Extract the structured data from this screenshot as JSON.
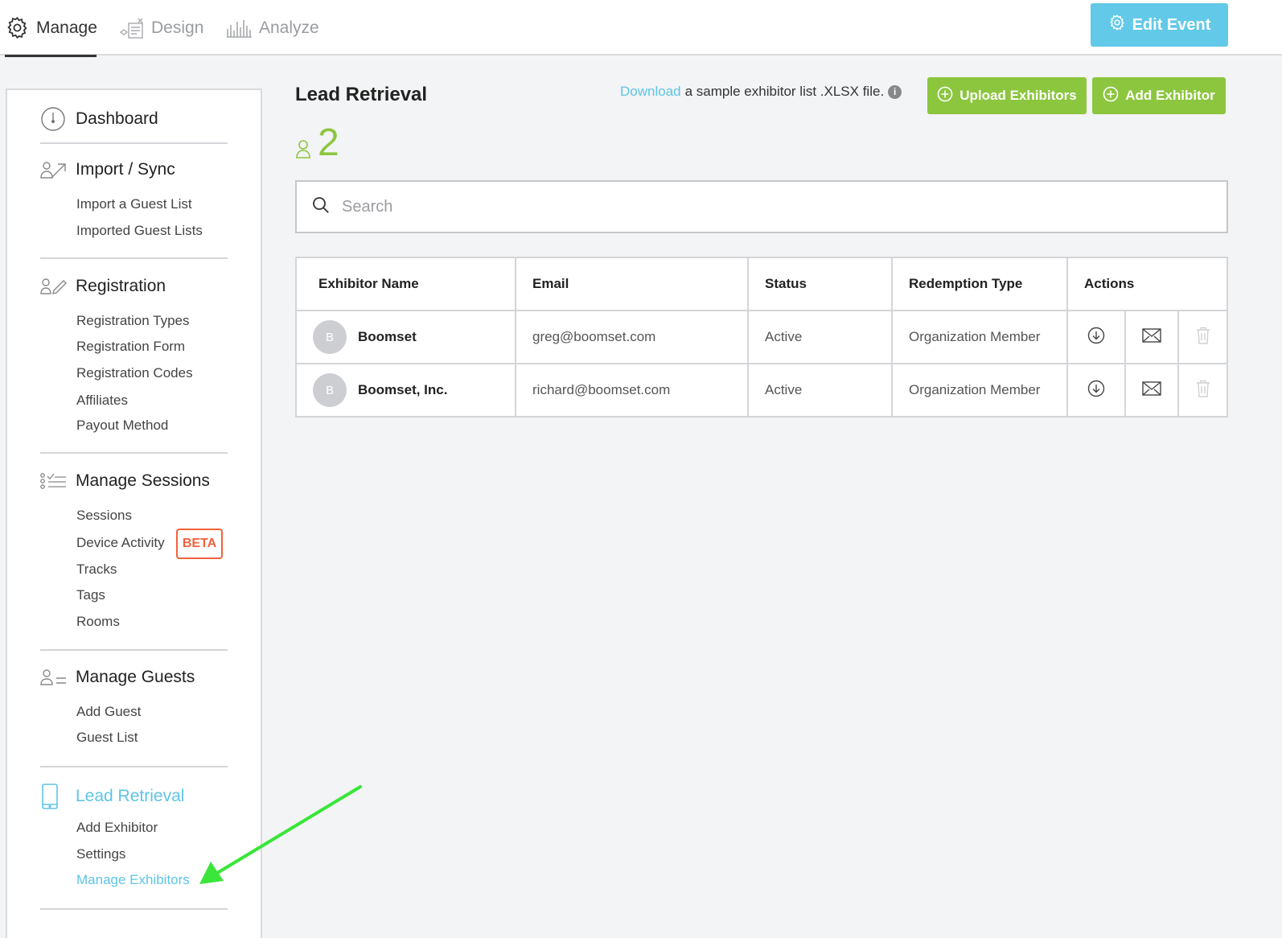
{
  "topnav": {
    "tabs": [
      {
        "label": "Manage",
        "icon": "gear-icon",
        "active": true
      },
      {
        "label": "Design",
        "icon": "design-icon",
        "active": false
      },
      {
        "label": "Analyze",
        "icon": "analyze-icon",
        "active": false
      }
    ],
    "edit_event_label": "Edit Event"
  },
  "sidebar": {
    "dashboard": "Dashboard",
    "import_sync": {
      "title": "Import / Sync",
      "items": [
        "Import a Guest List",
        "Imported Guest Lists"
      ]
    },
    "registration": {
      "title": "Registration",
      "items": [
        "Registration Types",
        "Registration Form",
        "Registration Codes",
        "Affiliates",
        "Payout Method"
      ]
    },
    "sessions": {
      "title": "Manage Sessions",
      "items": [
        "Sessions",
        "Device Activity",
        "Tracks",
        "Tags",
        "Rooms"
      ],
      "beta": "BETA"
    },
    "guests": {
      "title": "Manage Guests",
      "items": [
        "Add Guest",
        "Guest List"
      ]
    },
    "lead": {
      "title": "Lead Retrieval",
      "items": [
        "Add Exhibitor",
        "Settings",
        "Manage Exhibitors"
      ]
    }
  },
  "main": {
    "title": "Lead Retrieval",
    "count": "2",
    "hint": {
      "link": "Download",
      "text": "a sample exhibitor list .XLSX file.",
      "info": "i"
    },
    "upload_label": "Upload Exhibitors",
    "add_label": "Add Exhibitor",
    "search_placeholder": "Search"
  },
  "table": {
    "headers": [
      "Exhibitor Name",
      "Email",
      "Status",
      "Redemption Type",
      "Actions"
    ],
    "rows": [
      {
        "initial": "B",
        "name": "Boomset",
        "email": "greg@boomset.com",
        "status": "Active",
        "type": "Organization Member"
      },
      {
        "initial": "B",
        "name": "Boomset, Inc.",
        "email": "richard@boomset.com",
        "status": "Active",
        "type": "Organization Member"
      }
    ]
  },
  "colors": {
    "green": "#8cc63f",
    "blue": "#5ec4e5",
    "beta": "#f2613d",
    "annotation": "#39e639"
  }
}
